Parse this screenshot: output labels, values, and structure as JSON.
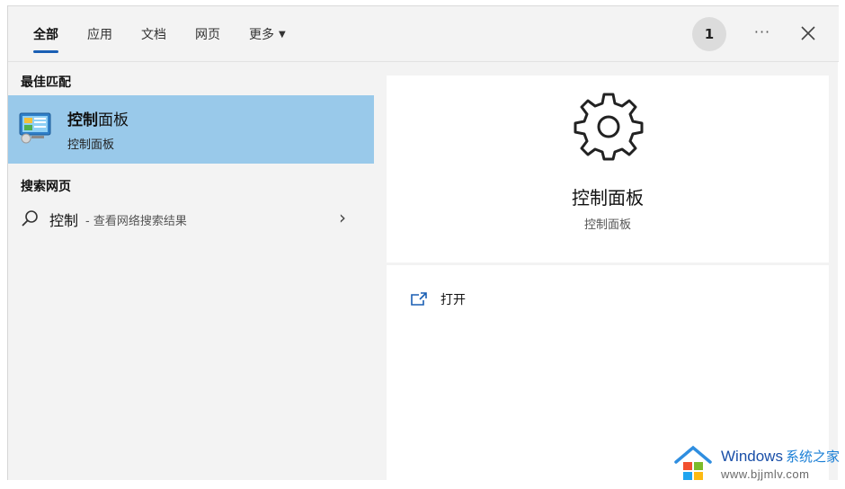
{
  "tabs": [
    {
      "label": "全部"
    },
    {
      "label": "应用"
    },
    {
      "label": "文档"
    },
    {
      "label": "网页"
    },
    {
      "label": "更多"
    }
  ],
  "header": {
    "badge": "1",
    "more_label": "···"
  },
  "best_match": {
    "section_title": "最佳匹配",
    "title_bold": "控制",
    "title_rest": "面板",
    "subtitle": "控制面板",
    "icon": "control-panel-icon"
  },
  "web": {
    "section_title": "搜索网页",
    "query": "控制",
    "hint": "- 查看网络搜索结果",
    "chevron": "›"
  },
  "preview": {
    "icon": "gear-icon",
    "title": "控制面板",
    "subtitle": "控制面板",
    "actions": [
      {
        "label": "打开",
        "icon": "open-icon"
      }
    ]
  },
  "watermark": {
    "brand": "Windows",
    "brand_cn": "系统之家",
    "url": "www.bjjmlv.com"
  },
  "colors": {
    "accent": "#1a5fb4",
    "selected_bg": "#99c9ea",
    "panel_bg": "#f3f3f3"
  }
}
